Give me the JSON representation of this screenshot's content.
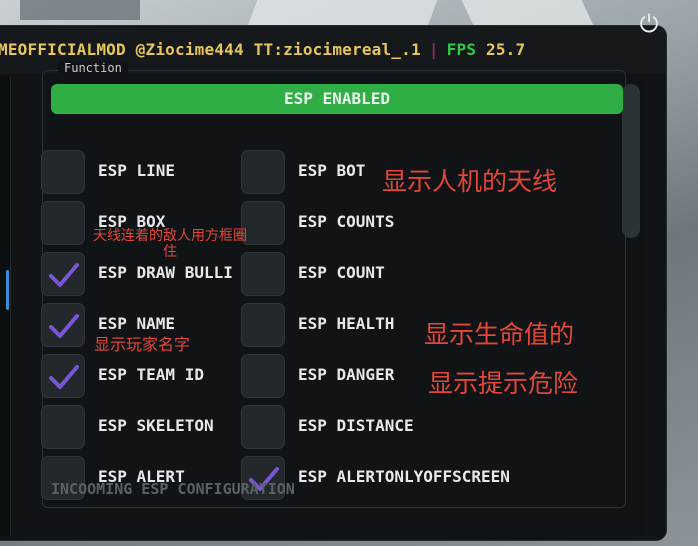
{
  "title": {
    "text": "MEOFFICIALMOD @Ziocime444 TT:ziocimereal_.1",
    "separator": "|",
    "fps_label": "FPS",
    "fps_value": "25.7"
  },
  "power_icon": "power-icon",
  "group": {
    "label": "Function",
    "esp_enabled_button": "ESP ENABLED"
  },
  "options": {
    "esp_line": {
      "label": "ESP LINE",
      "checked": false
    },
    "esp_bot": {
      "label": "ESP BOT",
      "checked": false
    },
    "esp_box": {
      "label": "ESP BOX",
      "checked": false
    },
    "esp_counts": {
      "label": "ESP COUNTS",
      "checked": false
    },
    "esp_draw_bullet": {
      "label": "ESP DRAW BULLI",
      "checked": true
    },
    "esp_count": {
      "label": "ESP COUNT",
      "checked": false
    },
    "esp_name": {
      "label": "ESP NAME",
      "checked": true
    },
    "esp_health": {
      "label": "ESP HEALTH",
      "checked": false
    },
    "esp_team_id": {
      "label": "ESP TEAM ID",
      "checked": true
    },
    "esp_danger": {
      "label": "ESP DANGER",
      "checked": false
    },
    "esp_skeleton": {
      "label": "ESP SKELETON",
      "checked": false
    },
    "esp_distance": {
      "label": "ESP DISTANCE",
      "checked": false
    },
    "esp_alert": {
      "label": "ESP ALERT",
      "checked": false
    },
    "esp_alertonlyoffscreen": {
      "label": "ESP ALERTONLYOFFSCREEN",
      "checked": true
    }
  },
  "footer": "INCOOMING ESP CONFIGURATION",
  "annotations": {
    "bot_antenna": "显示人机的天线",
    "box_note_line1": "天线连着的敌人用方框圈",
    "box_note_line2": "住",
    "name_note": "显示玩家名字",
    "health_note": "显示生命值的",
    "danger_note": "显示提示危险"
  },
  "colors": {
    "accent_green": "#2fae45",
    "title_yellow": "#e8c65a",
    "fps_green": "#2ecc48",
    "check_purple": "#7a55d6",
    "annotation_red": "#e2473a"
  }
}
